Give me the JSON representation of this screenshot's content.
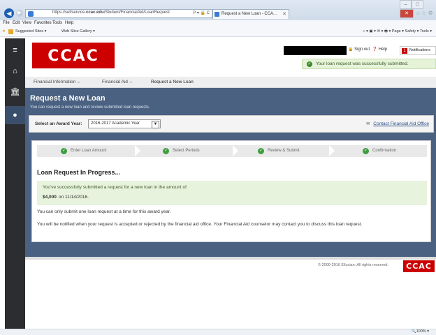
{
  "browser": {
    "url_host_prefix": "https://selfservice.",
    "url_host_bold": "ccac.edu",
    "url_path": "/Student/FinancialAid/LoanRequest",
    "addr_tools": "P ▾ 🔒 C",
    "tab_title": "Request a New Loan - CCA...",
    "menu": [
      "File",
      "Edit",
      "View",
      "Favorites",
      "Tools",
      "Help"
    ],
    "favorites": [
      "Suggested Sites ▾",
      "Web Slice Gallery ▾"
    ],
    "command_bar": "Page ▾  Safety ▾  Tools ▾"
  },
  "header": {
    "logo_text": "CCAC",
    "sign_out": "Sign out",
    "help": "Help",
    "notifications_count": "1",
    "notifications_label": "Notifications",
    "toast": "Your loan request was successfully submitted."
  },
  "breadcrumb": [
    "Financial Information",
    "Financial Aid",
    "Request a New Loan"
  ],
  "page": {
    "title": "Request a New Loan",
    "subtitle": "You can request a new loan and review submitted loan requests."
  },
  "award": {
    "label": "Select an Award Year:",
    "selected": "2016-2017 Academic Year",
    "contact_link": "Contact Financial Aid Office"
  },
  "steps": [
    "Enter Loan Amount",
    "Select Periods",
    "Review & Submit",
    "Confirmation"
  ],
  "status": {
    "title": "Loan Request In Progress...",
    "success_line": "You've successfully submitted a request for a new loan in the amount of",
    "amount": "$4,000",
    "date_text": "on 11/14/2016.",
    "note1": "You can only submit one loan request at a time for this award year.",
    "note2": "You will be notified when your request is accepted or rejected by the financial aid office. Your Financial Aid counselor may contact you to discuss this loan request."
  },
  "footer": {
    "copyright": "© 2000-2016 Ellucian. All rights reserved.",
    "logo_text": "CCAC",
    "zoom": "100%"
  }
}
